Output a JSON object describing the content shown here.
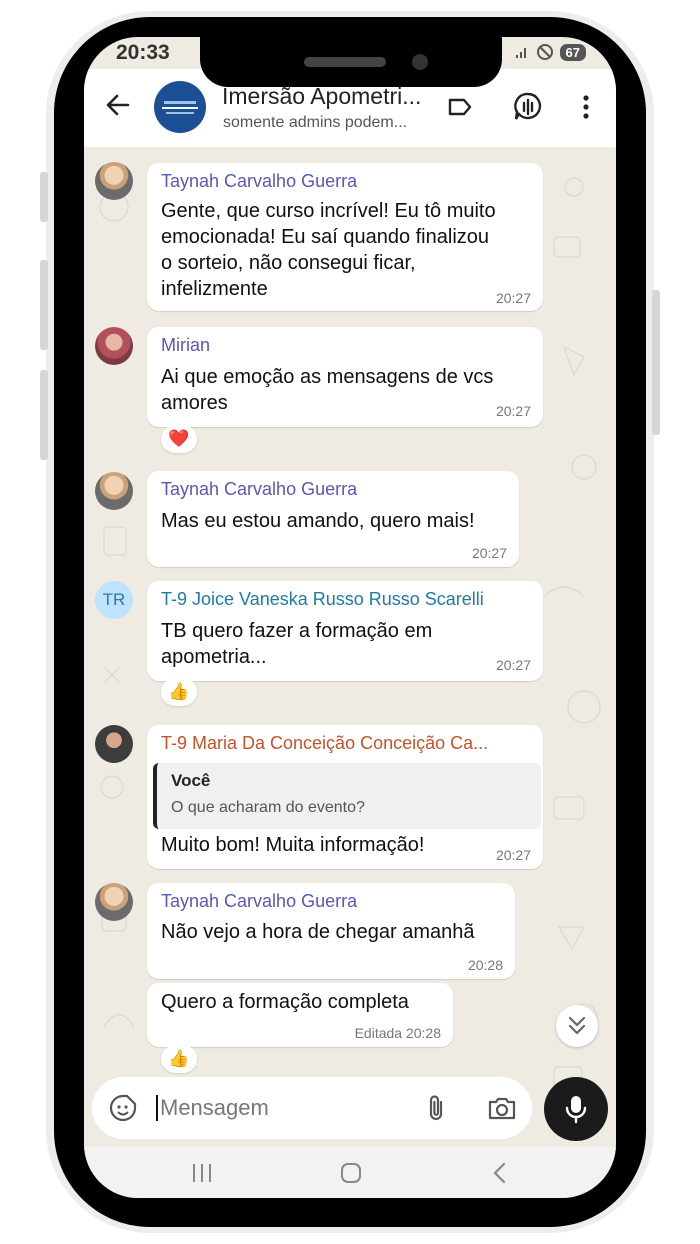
{
  "status_bar": {
    "time": "20:33",
    "battery": "67"
  },
  "header": {
    "group_name": "Imersão Apometri...",
    "subtitle": "somente admins podem...",
    "icons": [
      "back-arrow-icon",
      "label-icon",
      "voice-chat-icon",
      "more-vert-icon"
    ]
  },
  "messages": [
    {
      "sender": "Taynah Carvalho Guerra",
      "sender_color": "#5b57b5",
      "lines": [
        "Gente, que curso incrível! Eu tô muito",
        "emocionada! Eu saí quando finalizou",
        "o sorteio, não consegui ficar,",
        "infelizmente"
      ],
      "time": "20:27"
    },
    {
      "sender": "Mirian",
      "sender_color": "#5b57b5",
      "lines": [
        "Ai que emoção as mensagens de vcs",
        "amores"
      ],
      "time": "20:27",
      "reaction": "❤️"
    },
    {
      "sender": "Taynah Carvalho Guerra",
      "sender_color": "#5b57b5",
      "lines": [
        "Mas eu estou amando, quero mais!"
      ],
      "time": "20:27"
    },
    {
      "sender": "T-9 Joice Vaneska Russo Russo Scarelli",
      "sender_color": "#1f7aa5",
      "avatar_initials": "TR",
      "lines": [
        "TB quero fazer a formação em",
        "apometria..."
      ],
      "time": "20:27",
      "reaction": "👍"
    },
    {
      "sender": "T-9 Maria Da Conceição Conceição Ca...",
      "sender_color": "#c4532b",
      "quote_author": "Você",
      "quote_text": "O que acharam do evento?",
      "lines": [
        "Muito bom! Muita informação!"
      ],
      "time": "20:27"
    },
    {
      "sender": "Taynah Carvalho Guerra",
      "sender_color": "#5b57b5",
      "lines": [
        "Não vejo a hora de chegar amanhã"
      ],
      "time": "20:28"
    },
    {
      "lines": [
        "Quero a formação completa"
      ],
      "time": "Editada 20:28",
      "reaction": "👍"
    }
  ],
  "composer": {
    "placeholder": "Mensagem"
  },
  "colors": {
    "chat_background": "#efeae2",
    "bubble": "#ffffff",
    "mic_button": "#1b1b1b"
  }
}
